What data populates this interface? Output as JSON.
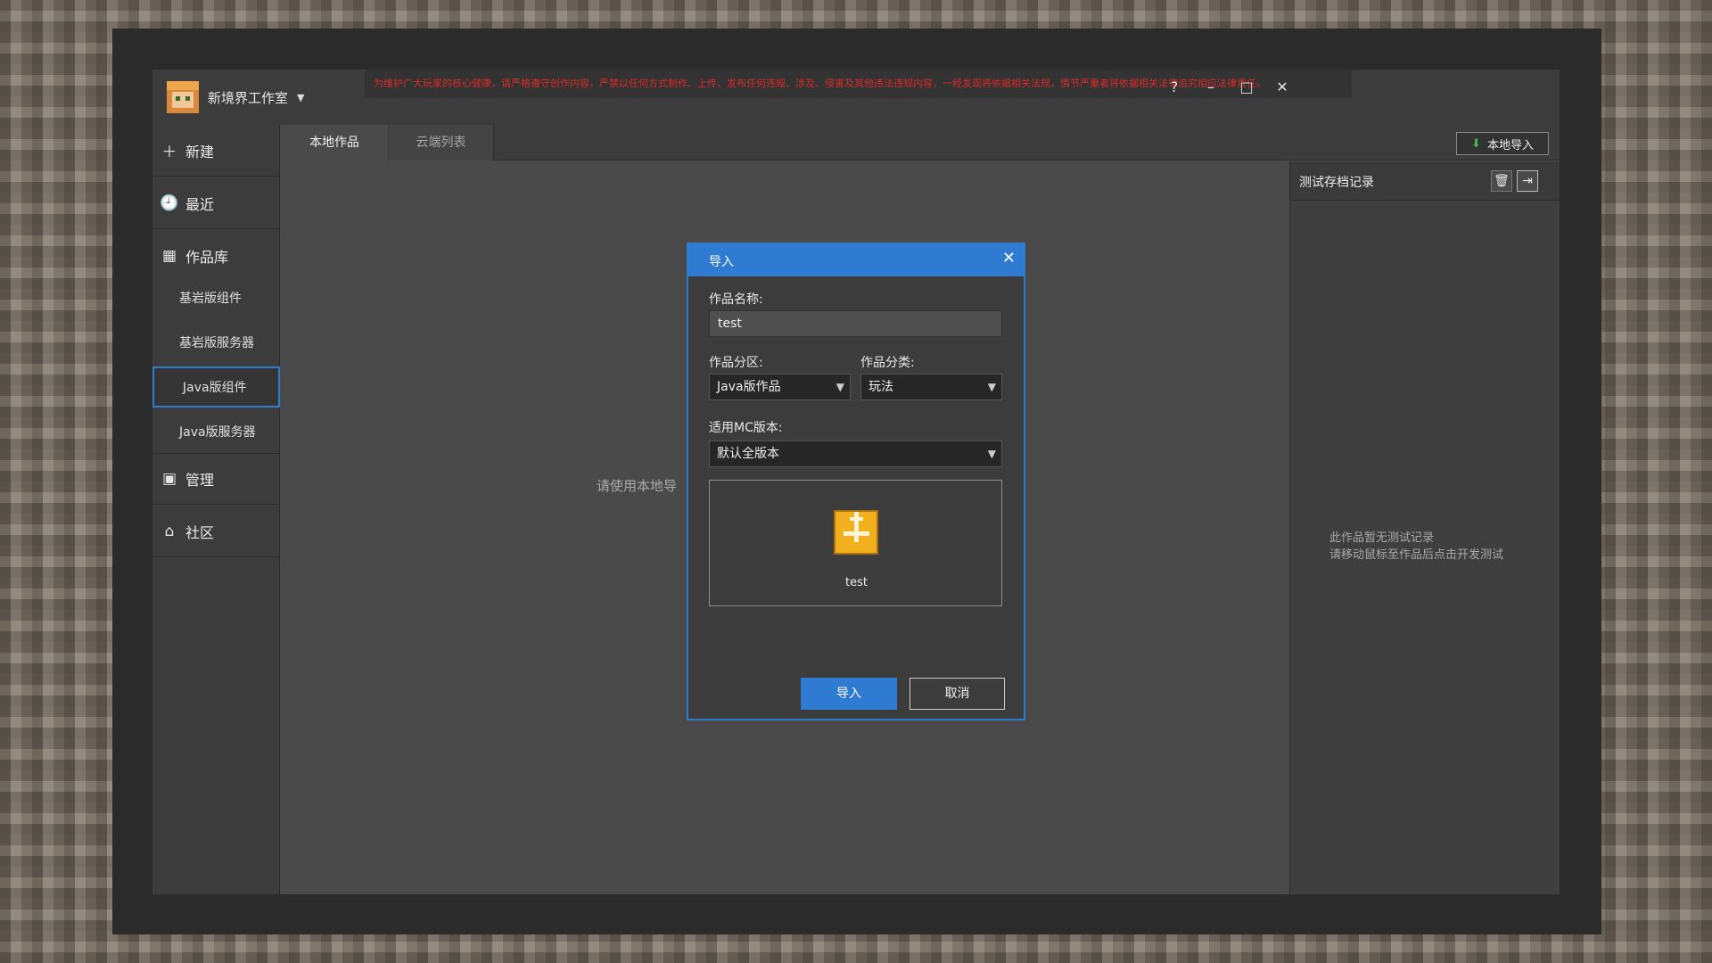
{
  "header": {
    "studio_name": "新境界工作室",
    "notice": "为维护广大玩家的核心健康，请严格遵守创作内容，严禁以任何方式制作、上传、发布任何违规、涉及、侵害及其他违法违规内容，一经发现将依据相关法规，情节严重者将依据相关法律追究相应法律责任。"
  },
  "window_controls": {
    "help": "?",
    "minimize": "–",
    "maximize": "□",
    "close": "✕"
  },
  "sidebar": {
    "new": "新建",
    "recent": "最近",
    "library": "作品库",
    "sub_items": [
      "基岩版组件",
      "基岩版服务器",
      "Java版组件",
      "Java版服务器"
    ],
    "manage": "管理",
    "community": "社区"
  },
  "tabs": {
    "local": "本地作品",
    "cloud": "云端列表"
  },
  "toolbar": {
    "import_local": "本地导入"
  },
  "main": {
    "empty_hint": "请使用本地导"
  },
  "right_panel": {
    "title": "测试存档记录",
    "empty_line1": "此作品暂无测试记录",
    "empty_line2": "请移动鼠标至作品后点击开发测试"
  },
  "modal": {
    "title": "导入",
    "name_label": "作品名称:",
    "name_value": "test",
    "zone_label": "作品分区:",
    "zone_value": "Java版作品",
    "category_label": "作品分类:",
    "category_value": "玩法",
    "version_label": "适用MC版本:",
    "version_value": "默认全版本",
    "preview_name": "test",
    "confirm": "导入",
    "cancel": "取消"
  },
  "colors": {
    "accent": "#2f7bd1",
    "notice_red": "#d82b2b",
    "import_icon_green": "#46b35a"
  }
}
